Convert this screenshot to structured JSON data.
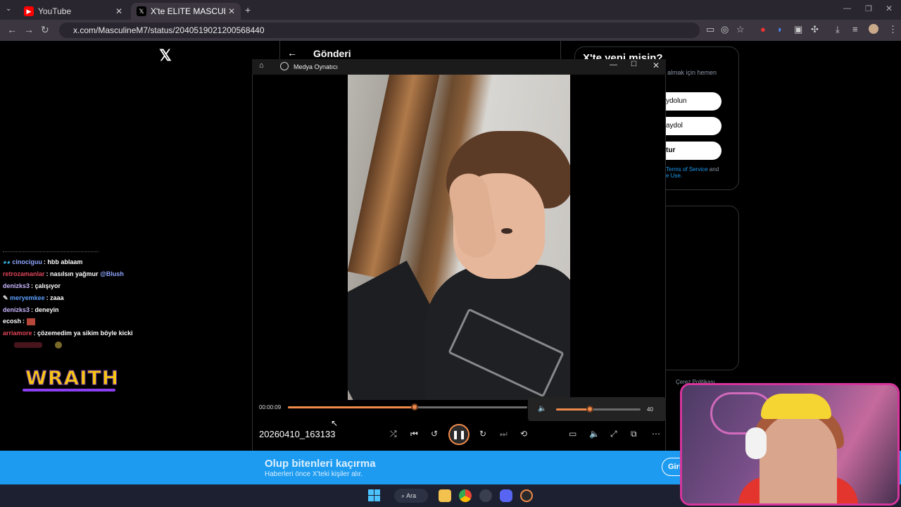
{
  "browser": {
    "tabs": [
      {
        "label": "YouTube",
        "icon": "youtube-icon"
      },
      {
        "label": "X'te ELITE MASCULINE: \"He ran",
        "icon": "x-icon"
      }
    ],
    "url": "x.com/MasculineM7/status/2040519021200568440"
  },
  "x_page": {
    "header_title": "Gönderi",
    "signup_title": "X'te yeni misin?",
    "signup_sub": "almak için hemen",
    "buttons": [
      "ydolun",
      "aydol",
      "tur"
    ],
    "terms_text": "Terms of Service",
    "terms_and": " and",
    "terms_use": "e Use.",
    "footer": "Çerez Politikası"
  },
  "chat": [
    {
      "user": "cinociguu",
      "msg": ": hbb ablaam",
      "color": "#8fa6ff"
    },
    {
      "user": "retrozamanlar",
      "msg": ": nasılsın yağmur ",
      "mention": "@Blush",
      "color": "#e0455a"
    },
    {
      "user": "denizks3",
      "msg": ": çalışıyor",
      "color": "#c9b8ff"
    },
    {
      "user": "meryemkee",
      "msg": ": zaaa",
      "color": "#5aa0ff"
    },
    {
      "user": "denizks3",
      "msg": ": deneyin",
      "color": "#c9b8ff"
    },
    {
      "user": "ecosh",
      "msg": ": ",
      "color": "#ffffff"
    },
    {
      "user": "arriamore",
      "msg": ": çözemedim ya sikim böyle kicki",
      "color": "#e0455a"
    }
  ],
  "overlay_logo": "WRAITH",
  "banner": {
    "title": "Olup bitenleri kaçırma",
    "subtitle": "Haberleri önce X'teki kişiler alır.",
    "login": "Giri"
  },
  "taskbar": {
    "search_label": "Ara"
  },
  "player": {
    "app_title": "Medya Oynatıcı",
    "current_time": "00:00:09",
    "progress": 0.53,
    "volume": 40,
    "volume_label": "40",
    "filename": "20260410_163133",
    "accent": "#f08a4b"
  }
}
